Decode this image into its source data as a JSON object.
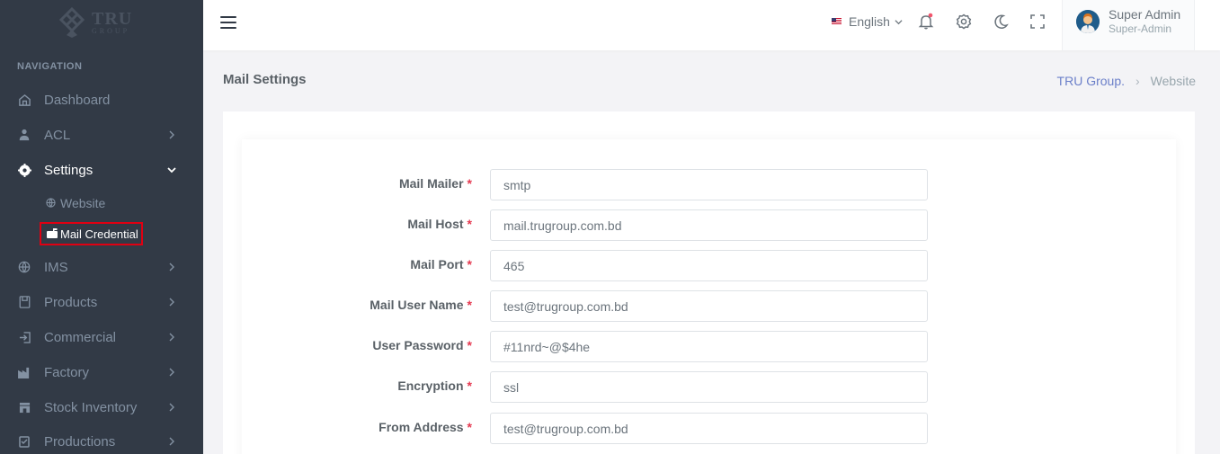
{
  "logo": {
    "big": "TRU",
    "small": "GROUP"
  },
  "sidebar": {
    "nav_title": "NAVIGATION",
    "items": [
      {
        "label": "Dashboard",
        "icon": "home-icon"
      },
      {
        "label": "ACL",
        "icon": "user-icon"
      },
      {
        "label": "Settings",
        "icon": "gear-icon"
      },
      {
        "label": "IMS",
        "icon": "globe-icon"
      },
      {
        "label": "Products",
        "icon": "box-icon"
      },
      {
        "label": "Commercial",
        "icon": "login-icon"
      },
      {
        "label": "Factory",
        "icon": "factory-icon"
      },
      {
        "label": "Stock Inventory",
        "icon": "store-icon"
      },
      {
        "label": "Productions",
        "icon": "clipboard-icon"
      }
    ],
    "settings_sub": [
      {
        "label": "Website",
        "icon": "globe-icon"
      },
      {
        "label": "Mail Credential",
        "icon": "mailbox-icon"
      }
    ]
  },
  "topbar": {
    "language": "English",
    "user_name": "Super Admin",
    "user_role": "Super-Admin"
  },
  "page": {
    "title": "Mail Settings",
    "breadcrumb": [
      "TRU Group.",
      "Website"
    ]
  },
  "form": {
    "required_mark": "*",
    "fields": [
      {
        "label": "Mail Mailer",
        "value": "smtp"
      },
      {
        "label": "Mail Host",
        "value": "mail.trugroup.com.bd"
      },
      {
        "label": "Mail Port",
        "value": "465"
      },
      {
        "label": "Mail User Name",
        "value": "test@trugroup.com.bd"
      },
      {
        "label": "User Password",
        "value": "#11nrd~@$4he"
      },
      {
        "label": "Encryption",
        "value": "ssl"
      },
      {
        "label": "From Address",
        "value": "test@trugroup.com.bd"
      }
    ]
  },
  "colors": {
    "sidebar_bg": "#323a46",
    "highlight_border": "#e00012",
    "required": "#e53950",
    "link": "#6b7fc9"
  }
}
